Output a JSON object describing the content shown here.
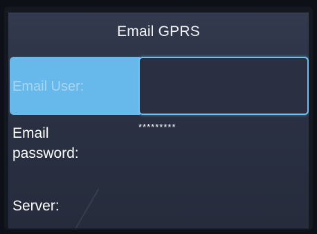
{
  "screen": {
    "title": "Email GPRS"
  },
  "fields": {
    "email_user": {
      "label": "Email User:",
      "value": ""
    },
    "email_password": {
      "label_line1": "Email",
      "label_line2": "password:",
      "value": "*********"
    },
    "server": {
      "label": "Server:"
    }
  },
  "colors": {
    "screen_background": "#2b3244",
    "selection_highlight": "#66b9ea",
    "field_border": "#6cc3f3",
    "text": "#ffffff"
  }
}
